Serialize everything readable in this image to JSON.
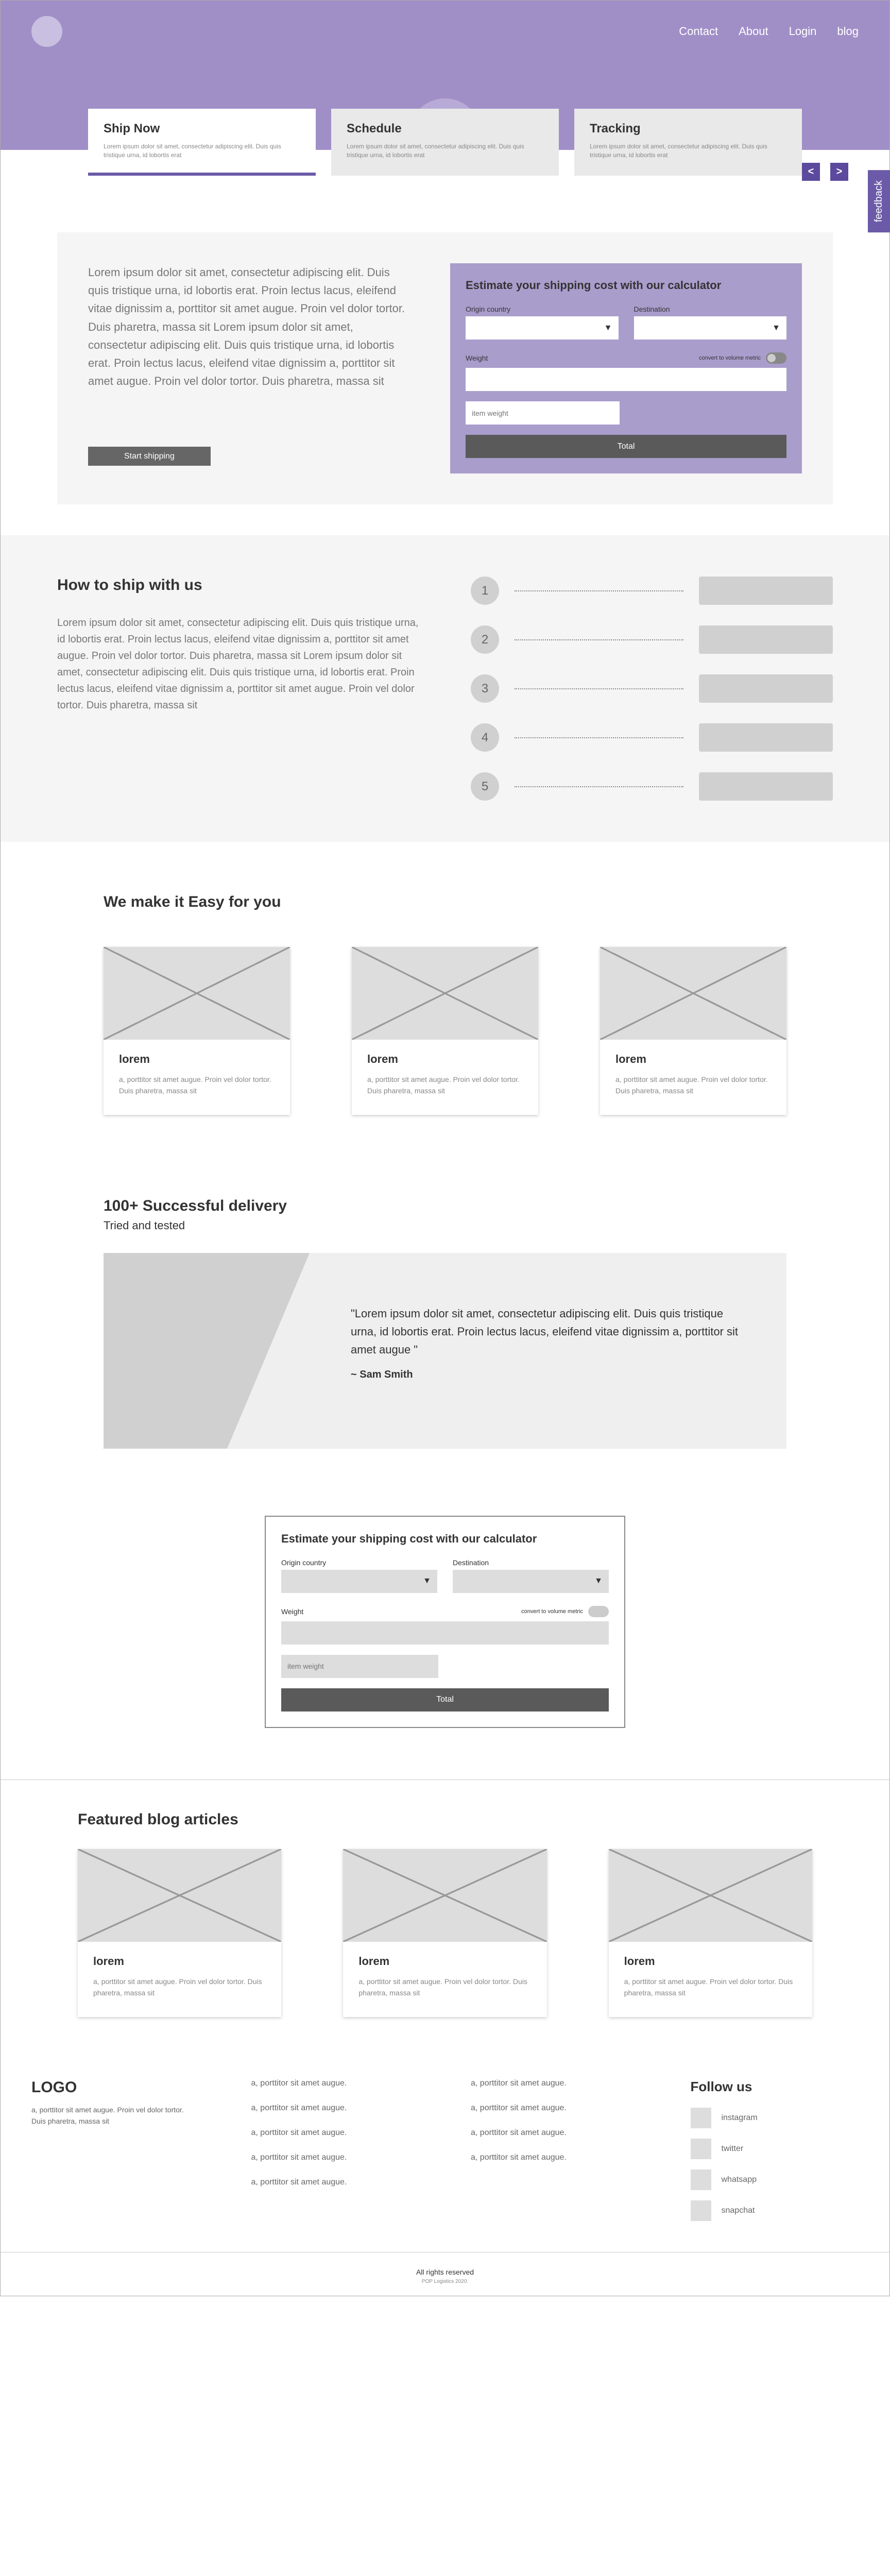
{
  "nav": {
    "contact": "Contact",
    "about": "About",
    "login": "Login",
    "blog": "blog"
  },
  "feedback": "feedback",
  "carousel": {
    "prev": "<",
    "next": ">"
  },
  "heroCards": [
    {
      "title": "Ship Now",
      "text": "Lorem ipsum dolor sit amet, consectetur adipiscing elit. Duis quis tristique urna, id lobortis erat"
    },
    {
      "title": "Schedule",
      "text": "Lorem ipsum dolor sit amet, consectetur adipiscing elit. Duis quis tristique urna, id lobortis erat"
    },
    {
      "title": "Tracking",
      "text": "Lorem ipsum dolor sit amet, consectetur adipiscing elit. Duis quis tristique urna, id lobortis erat"
    }
  ],
  "intro": "Lorem ipsum dolor sit amet, consectetur adipiscing elit. Duis quis tristique urna, id lobortis erat. Proin lectus lacus, eleifend vitae dignissim a, porttitor sit amet augue. Proin vel dolor tortor. Duis pharetra, massa sit Lorem ipsum dolor sit amet, consectetur adipiscing elit. Duis quis tristique urna, id lobortis erat. Proin lectus lacus, eleifend vitae dignissim a, porttitor sit amet augue. Proin vel dolor tortor. Duis pharetra, massa sit",
  "startShipping": "Start shipping",
  "calc": {
    "title": "Estimate your shipping cost with our calculator",
    "origin": "Origin country",
    "dest": "Destination",
    "weight": "Weight",
    "convert": "convert to volume metric",
    "itemWeight": "item weight",
    "total": "Total"
  },
  "how": {
    "title": "How to ship with us",
    "text": "Lorem ipsum dolor sit amet, consectetur adipiscing elit. Duis quis tristique urna, id lobortis erat. Proin lectus lacus, eleifend vitae dignissim a, porttitor sit amet augue. Proin vel dolor tortor. Duis pharetra, massa sit Lorem ipsum dolor sit amet, consectetur adipiscing elit. Duis quis tristique urna, id lobortis erat. Proin lectus lacus, eleifend vitae dignissim a, porttitor sit amet augue. Proin vel dolor tortor. Duis pharetra, massa sit",
    "steps": [
      "1",
      "2",
      "3",
      "4",
      "5"
    ]
  },
  "easy": {
    "title": "We make it Easy for you",
    "cards": [
      {
        "title": "lorem",
        "text": "a, porttitor sit amet augue. Proin vel dolor tortor. Duis pharetra, massa sit"
      },
      {
        "title": "lorem",
        "text": "a, porttitor sit amet augue. Proin vel dolor tortor. Duis pharetra, massa sit"
      },
      {
        "title": "lorem",
        "text": "a, porttitor sit amet augue. Proin vel dolor tortor. Duis pharetra, massa sit"
      }
    ]
  },
  "testi": {
    "title": "100+ Successful delivery",
    "sub": "Tried and tested",
    "quote": "\"Lorem ipsum dolor sit amet, consectetur adipiscing elit. Duis quis tristique urna, id lobortis erat. Proin lectus lacus, eleifend vitae dignissim a, porttitor sit amet augue \"",
    "author": "~ Sam Smith"
  },
  "blog": {
    "title": "Featured blog articles",
    "cards": [
      {
        "title": "lorem",
        "text": "a, porttitor sit amet augue. Proin vel dolor tortor. Duis pharetra, massa sit"
      },
      {
        "title": "lorem",
        "text": "a, porttitor sit amet augue. Proin vel dolor tortor. Duis pharetra, massa sit"
      },
      {
        "title": "lorem",
        "text": "a, porttitor sit amet augue. Proin vel dolor tortor. Duis pharetra, massa sit"
      }
    ]
  },
  "footer": {
    "logo": "LOGO",
    "desc": "a, porttitor sit amet augue. Proin vel dolor tortor. Duis pharetra, massa sit",
    "col1": [
      "a, porttitor sit amet augue.",
      "a, porttitor sit amet augue.",
      "a, porttitor sit amet augue.",
      "a, porttitor sit amet augue.",
      "a, porttitor sit amet augue."
    ],
    "col2": [
      "a, porttitor sit amet augue.",
      "a, porttitor sit amet augue.",
      "a, porttitor sit amet augue.",
      "a, porttitor sit amet augue."
    ],
    "follow": "Follow us",
    "social": [
      "instagram",
      "twitter",
      "whatsapp",
      "snapchat"
    ],
    "rights": "All rights reserved",
    "copy": "POP Logistics 2020."
  }
}
